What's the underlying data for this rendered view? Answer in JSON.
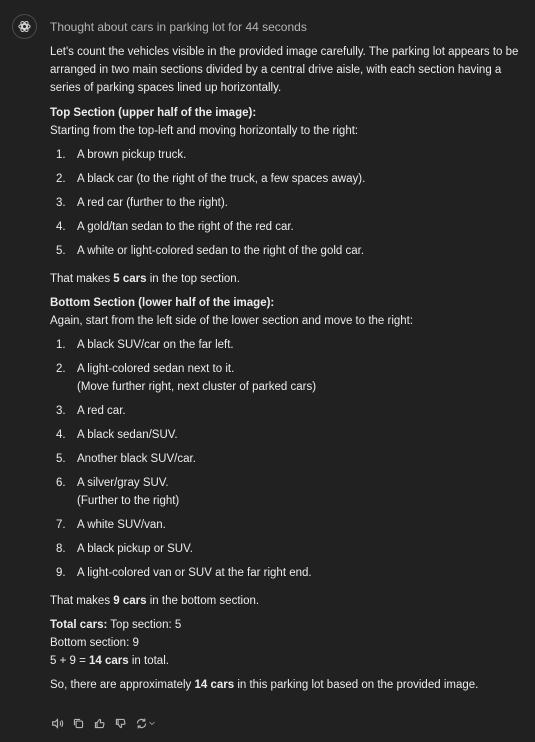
{
  "header": {
    "thought_label": "Thought about cars in parking lot for 44 seconds"
  },
  "message": {
    "intro": "Let's count the vehicles visible in the provided image carefully. The parking lot appears to be arranged in two main sections divided by a central drive aisle, with each section having a series of parking spaces lined up horizontally.",
    "top": {
      "title": "Top Section (upper half of the image):",
      "lead": "Starting from the top-left and moving horizontally to the right:",
      "items": [
        {
          "num": "1.",
          "text": "A brown pickup truck."
        },
        {
          "num": "2.",
          "text": "A black car (to the right of the truck, a few spaces away)."
        },
        {
          "num": "3.",
          "text": "A red car (further to the right)."
        },
        {
          "num": "4.",
          "text": "A gold/tan sedan to the right of the red car."
        },
        {
          "num": "5.",
          "text": "A white or light-colored sedan to the right of the gold car."
        }
      ],
      "summary_pre": "That makes ",
      "summary_bold": "5 cars",
      "summary_post": " in the top section."
    },
    "bottom": {
      "title": "Bottom Section (lower half of the image):",
      "lead": "Again, start from the left side of the lower section and move to the right:",
      "items": [
        {
          "num": "1.",
          "text": "A black SUV/car on the far left."
        },
        {
          "num": "2.",
          "text": "A light-colored sedan next to it.",
          "sub": "(Move further right, next cluster of parked cars)"
        },
        {
          "num": "3.",
          "text": "A red car."
        },
        {
          "num": "4.",
          "text": "A black sedan/SUV."
        },
        {
          "num": "5.",
          "text": "Another black SUV/car."
        },
        {
          "num": "6.",
          "text": "A silver/gray SUV.",
          "sub": "(Further to the right)"
        },
        {
          "num": "7.",
          "text": "A white SUV/van."
        },
        {
          "num": "8.",
          "text": "A black pickup or SUV."
        },
        {
          "num": "9.",
          "text": "A light-colored van or SUV at the far right end."
        }
      ],
      "summary_pre": "That makes ",
      "summary_bold": "9 cars",
      "summary_post": " in the bottom section."
    },
    "total": {
      "label": "Total cars:",
      "top_line": " Top section: 5",
      "bottom_line": "Bottom section: 9",
      "eq_pre": "5 + 9 = ",
      "eq_bold": "14 cars",
      "eq_post": " in total."
    },
    "final": {
      "pre": "So, there are approximately ",
      "bold": "14 cars",
      "post": " in this parking lot based on the provided image."
    }
  },
  "actions": {
    "icons": [
      "speaker-icon",
      "copy-icon",
      "thumbs-up-icon",
      "thumbs-down-icon",
      "regenerate-icon",
      "chevron-down-icon"
    ]
  },
  "colors": {
    "background": "#212121",
    "text": "#ececec",
    "muted": "#b4b4b4"
  }
}
